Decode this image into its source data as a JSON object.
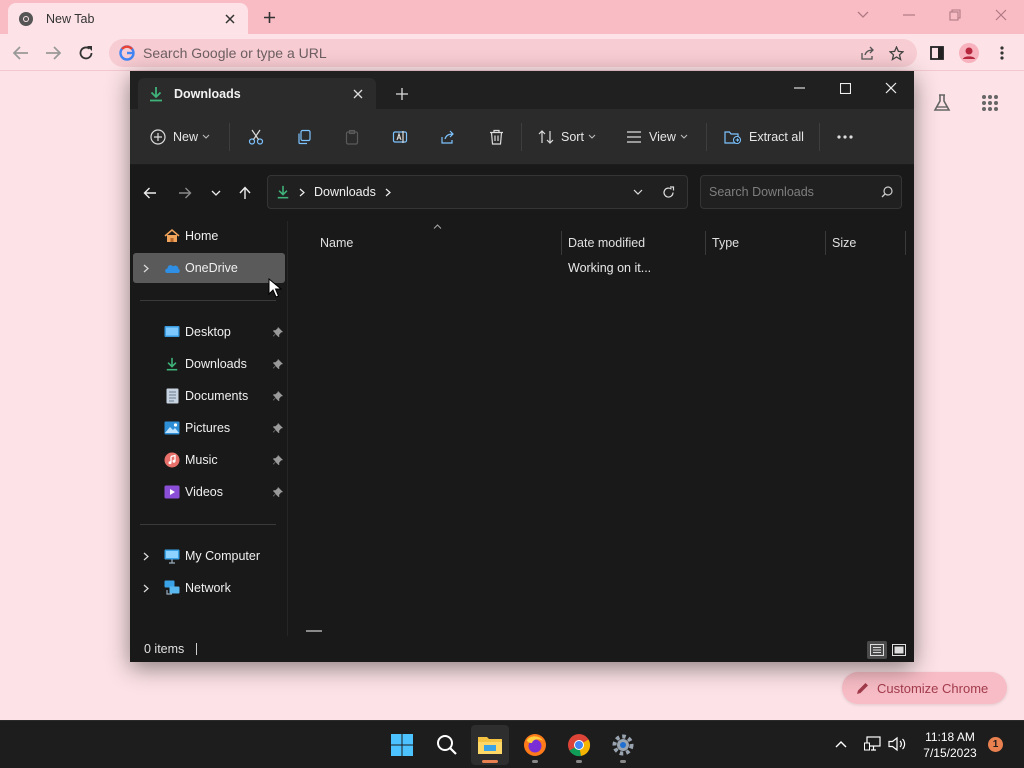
{
  "chrome": {
    "tab_title": "New Tab",
    "omnibox_placeholder": "Search Google or type a URL",
    "customize_label": "Customize Chrome"
  },
  "explorer": {
    "tab_title": "Downloads",
    "toolbar": {
      "new_label": "New",
      "sort_label": "Sort",
      "view_label": "View",
      "extract_label": "Extract all"
    },
    "address": {
      "crumb": "Downloads"
    },
    "search_placeholder": "Search Downloads",
    "sidebar": {
      "top": [
        {
          "label": "Home",
          "icon": "home-icon"
        },
        {
          "label": "OneDrive",
          "icon": "onedrive-icon",
          "selected": true
        }
      ],
      "pinned": [
        {
          "label": "Desktop",
          "icon": "desktop-folder-icon"
        },
        {
          "label": "Downloads",
          "icon": "downloads-folder-icon"
        },
        {
          "label": "Documents",
          "icon": "documents-folder-icon"
        },
        {
          "label": "Pictures",
          "icon": "pictures-folder-icon"
        },
        {
          "label": "Music",
          "icon": "music-folder-icon"
        },
        {
          "label": "Videos",
          "icon": "videos-folder-icon"
        }
      ],
      "bottom": [
        {
          "label": "My Computer",
          "icon": "computer-icon"
        },
        {
          "label": "Network",
          "icon": "network-icon"
        }
      ]
    },
    "columns": [
      "Name",
      "Date modified",
      "Type",
      "Size"
    ],
    "loading_text": "Working on it...",
    "status_items": "0 items"
  },
  "taskbar": {
    "time": "11:18 AM",
    "date": "7/15/2023",
    "notification_count": "1"
  },
  "colors": {
    "chrome_bg": "#fde3e7",
    "chrome_tabbar": "#f9bcc5",
    "explorer_bg": "#191919",
    "accent_green": "#3fb37a",
    "taskbar_accent": "#e8804f"
  }
}
